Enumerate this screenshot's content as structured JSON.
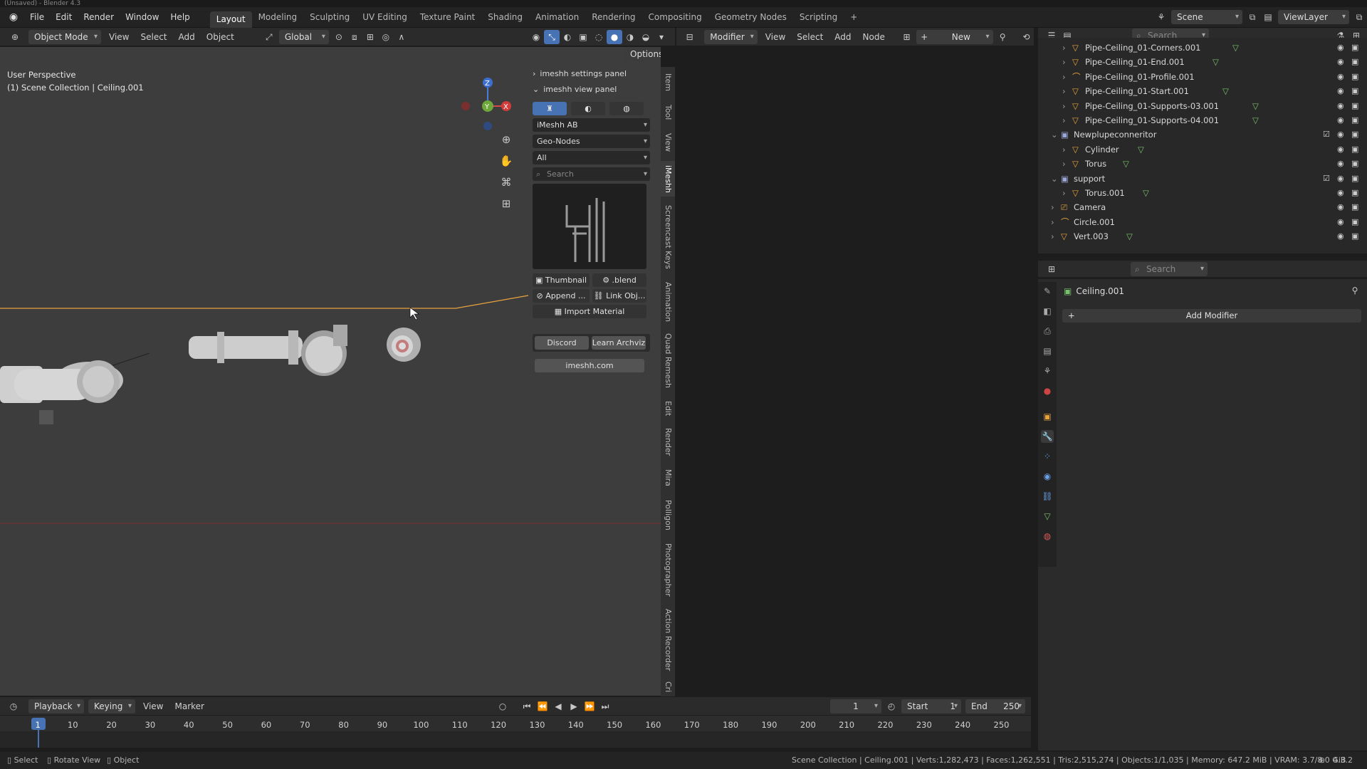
{
  "window": {
    "title": "(Unsaved) - Blender 4.3"
  },
  "topbar": {
    "menus": [
      "File",
      "Edit",
      "Render",
      "Window",
      "Help"
    ],
    "workspaces": [
      "Layout",
      "Modeling",
      "Sculpting",
      "UV Editing",
      "Texture Paint",
      "Shading",
      "Animation",
      "Rendering",
      "Compositing",
      "Geometry Nodes",
      "Scripting"
    ],
    "active_workspace": "Layout",
    "add_tab": "+",
    "scene": "Scene",
    "view_layer": "ViewLayer"
  },
  "viewport_header": {
    "mode": "Object Mode",
    "menus": [
      "View",
      "Select",
      "Add",
      "Object"
    ],
    "transform": "Global",
    "options": "Options"
  },
  "viewport": {
    "perspective": "User Perspective",
    "collection": "(1) Scene Collection | Ceiling.001",
    "gizmo": {
      "z": "Z",
      "x": "X",
      "y": "Y"
    }
  },
  "npanel": {
    "settings_panel": "imeshh settings panel",
    "view_panel": "imeshh view panel",
    "library": "iMeshh AB",
    "category": "Geo-Nodes",
    "filter": "All",
    "search_placeholder": "Search",
    "thumbnail_btn": "Thumbnail",
    "blend_btn": ".blend",
    "append_btn": "Append ...",
    "link_btn": "Link Obj...",
    "import_material_btn": "Import Material",
    "discord_btn": "Discord",
    "learn_btn": "Learn Archviz",
    "site_btn": "imeshh.com"
  },
  "sidebar_tabs": [
    "Item",
    "Tool",
    "View",
    "iMeshh",
    "Screencast Keys",
    "Animation",
    "Quad Remesh",
    "Edit",
    "Render",
    "Mira",
    "Polligon",
    "Photographer",
    "Action Recorder",
    "Cri"
  ],
  "node_editor": {
    "editor": "Modifier",
    "menus": [
      "View",
      "Select",
      "Add",
      "Node"
    ],
    "new_btn": "New"
  },
  "outliner": {
    "search_placeholder": "Search",
    "rows": [
      {
        "name": "Pipe-Ceiling_01-Corners.001",
        "indent": 3,
        "type": "mesh"
      },
      {
        "name": "Pipe-Ceiling_01-End.001",
        "indent": 3,
        "type": "mesh"
      },
      {
        "name": "Pipe-Ceiling_01-Profile.001",
        "indent": 3,
        "type": "curve"
      },
      {
        "name": "Pipe-Ceiling_01-Start.001",
        "indent": 3,
        "type": "mesh"
      },
      {
        "name": "Pipe-Ceiling_01-Supports-03.001",
        "indent": 3,
        "type": "mesh"
      },
      {
        "name": "Pipe-Ceiling_01-Supports-04.001",
        "indent": 3,
        "type": "mesh"
      },
      {
        "name": "Newplupeconneritor",
        "indent": 2,
        "type": "collection"
      },
      {
        "name": "Cylinder",
        "indent": 3,
        "type": "mesh"
      },
      {
        "name": "Torus",
        "indent": 3,
        "type": "mesh"
      },
      {
        "name": "support",
        "indent": 2,
        "type": "collection"
      },
      {
        "name": "Torus.001",
        "indent": 3,
        "type": "mesh"
      },
      {
        "name": "Camera",
        "indent": 2,
        "type": "camera"
      },
      {
        "name": "Circle.001",
        "indent": 2,
        "type": "curve"
      },
      {
        "name": "Vert.003",
        "indent": 2,
        "type": "mesh"
      }
    ]
  },
  "properties": {
    "search_placeholder": "Search",
    "object_name": "Ceiling.001",
    "add_modifier": "Add Modifier"
  },
  "timeline": {
    "menus": [
      "Playback",
      "Keying",
      "View",
      "Marker"
    ],
    "current_frame": "1",
    "start_label": "Start",
    "start": "1",
    "end_label": "End",
    "end": "250",
    "ticks": [
      "1",
      "10",
      "20",
      "30",
      "40",
      "50",
      "60",
      "70",
      "80",
      "90",
      "100",
      "110",
      "120",
      "130",
      "140",
      "150",
      "160",
      "170",
      "180",
      "190",
      "200",
      "210",
      "220",
      "230",
      "240",
      "250"
    ]
  },
  "statusbar": {
    "select": "Select",
    "rotate": "Rotate View",
    "object": "Object",
    "stats": "Scene Collection | Ceiling.001 | Verts:1,282,473 | Faces:1,262,551 | Tris:2,515,274 | Objects:1/1,035 | Memory: 647.2 MiB | VRAM: 3.7/8.0 GiB",
    "version": "4.3.2"
  },
  "colors": {
    "accent": "#4772b3",
    "selection": "#e7a33f"
  }
}
